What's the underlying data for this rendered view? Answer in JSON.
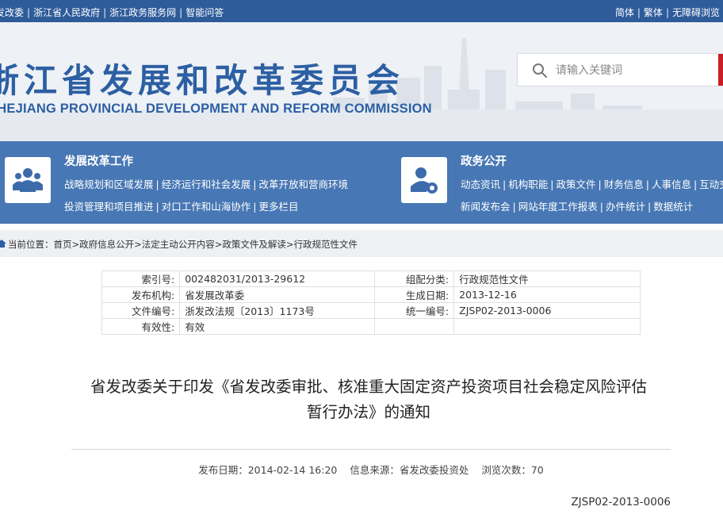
{
  "topbar": {
    "left_links": [
      "发改委",
      "浙江省人民政府",
      "浙江政务服务网",
      "智能问答"
    ],
    "right_links": [
      "简体",
      "繁体",
      "无障碍浏览"
    ]
  },
  "header": {
    "title_zh": "浙江省发展和改革委员会",
    "title_en": "ZHEJIANG PROVINCIAL DEVELOPMENT AND REFORM COMMISSION",
    "search_placeholder": "请输入关键词"
  },
  "nav": {
    "reform": {
      "title": "发展改革工作",
      "row1": [
        "战略规划和区域发展",
        "经济运行和社会发展",
        "改革开放和营商环境"
      ],
      "row2": [
        "投资管理和项目推进",
        "对口工作和山海协作",
        "更多栏目"
      ]
    },
    "affairs": {
      "title": "政务公开",
      "row1": [
        "动态资讯",
        "机构职能",
        "政策文件",
        "财务信息",
        "人事信息",
        "互动交流"
      ],
      "row2": [
        "新闻发布会",
        "网站年度工作报表",
        "办件统计",
        "数据统计"
      ]
    }
  },
  "breadcrumb": {
    "prefix": "当前位置：",
    "items": [
      "首页",
      "政府信息公开",
      "法定主动公开内容",
      "政策文件及解读",
      "行政规范性文件"
    ]
  },
  "meta": {
    "index_label": "索引号:",
    "index_value": "002482031/2013-29612",
    "category_label": "组配分类:",
    "category_value": "行政规范性文件",
    "org_label": "发布机构:",
    "org_value": "省发展改革委",
    "date_label": "生成日期:",
    "date_value": "2013-12-16",
    "fileno_label": "文件编号:",
    "fileno_value": "浙发改法规〔2013〕1173号",
    "uniform_label": "统一编号:",
    "uniform_value": "ZJSP02-2013-0006",
    "valid_label": "有效性:",
    "valid_value": "有效"
  },
  "article": {
    "title_line1": "省发改委关于印发《省发改委审批、核准重大固定资产投资项目社会稳定风险评估",
    "title_line2": "暂行办法》的通知",
    "pub_date": "发布日期：2014-02-14 16:20",
    "source": "信息来源：省发改委投资处",
    "views": "浏览次数：70",
    "doc_number": "ZJSP02-2013-0006"
  },
  "colors": {
    "topbar": "#2e5b9a",
    "nav": "#4777b4",
    "title": "#2c5fa3",
    "search_accent": "#c81d25"
  }
}
